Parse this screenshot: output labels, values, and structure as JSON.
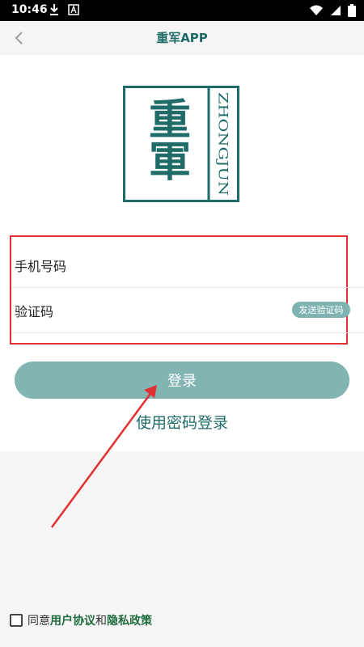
{
  "status_bar": {
    "time": "10:46"
  },
  "header": {
    "title": "重军APP"
  },
  "logo": {
    "chinese_text": "重軍",
    "latin_text": "ZHONGJUN",
    "color": "#1e6b68"
  },
  "form": {
    "phone_placeholder": "手机号码",
    "code_placeholder": "验证码",
    "send_code_label": "发送验证码"
  },
  "login_button_label": "登录",
  "password_login_label": "使用密码登录",
  "agreement": {
    "prefix": "同意",
    "user_agreement": "用户协议",
    "conjunction": "和",
    "privacy_policy": "隐私政策"
  },
  "colors": {
    "accent": "#82b4b1",
    "brand": "#1e6b68",
    "annotation": "#e03030"
  }
}
